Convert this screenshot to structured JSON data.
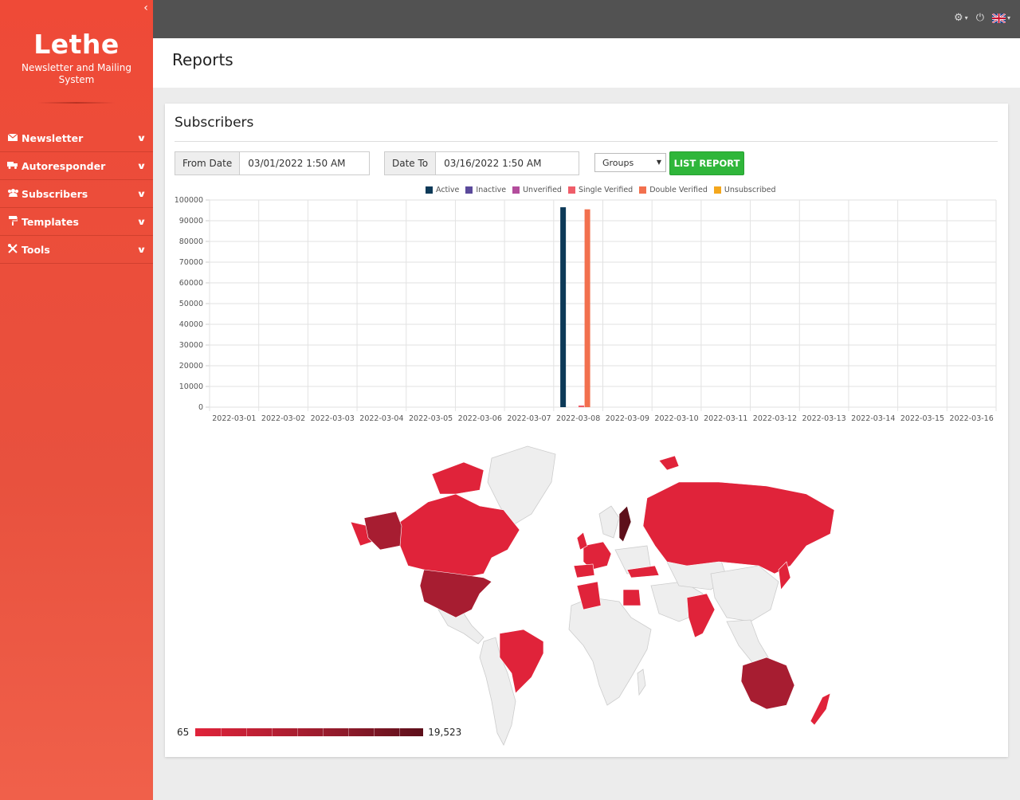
{
  "app": {
    "brand_title": "Lethe",
    "brand_subtitle": "Newsletter and Mailing System",
    "collapse_icon": "chevron-left-icon"
  },
  "sidebar": {
    "items": [
      {
        "label": "Newsletter",
        "icon": "envelope-icon"
      },
      {
        "label": "Autoresponder",
        "icon": "truck-icon"
      },
      {
        "label": "Subscribers",
        "icon": "users-icon"
      },
      {
        "label": "Templates",
        "icon": "paint-roller-icon"
      },
      {
        "label": "Tools",
        "icon": "tools-icon"
      }
    ]
  },
  "topbar": {
    "icons": [
      "gear-icon",
      "power-icon",
      "uk-flag-icon"
    ]
  },
  "page": {
    "title": "Reports"
  },
  "card": {
    "title": "Subscribers",
    "filters": {
      "from_label": "From Date",
      "from_value": "03/01/2022 1:50 AM",
      "to_label": "Date To",
      "to_value": "03/16/2022 1:50 AM",
      "groups_label": "Groups",
      "button_label": "LIST REPORT"
    }
  },
  "chart_data": {
    "type": "bar",
    "categories": [
      "2022-03-01",
      "2022-03-02",
      "2022-03-03",
      "2022-03-04",
      "2022-03-05",
      "2022-03-06",
      "2022-03-07",
      "2022-03-08",
      "2022-03-09",
      "2022-03-10",
      "2022-03-11",
      "2022-03-12",
      "2022-03-13",
      "2022-03-14",
      "2022-03-15",
      "2022-03-16"
    ],
    "series": [
      {
        "name": "Active",
        "color": "#0d3a58",
        "values": [
          0,
          0,
          0,
          0,
          0,
          0,
          0,
          96500,
          0,
          0,
          0,
          0,
          0,
          0,
          0,
          0
        ]
      },
      {
        "name": "Inactive",
        "color": "#5b4a9b",
        "values": [
          0,
          0,
          0,
          0,
          0,
          0,
          0,
          0,
          0,
          0,
          0,
          0,
          0,
          0,
          0,
          0
        ]
      },
      {
        "name": "Unverified",
        "color": "#b34d9c",
        "values": [
          0,
          0,
          0,
          0,
          0,
          0,
          0,
          0,
          0,
          0,
          0,
          0,
          0,
          0,
          0,
          0
        ]
      },
      {
        "name": "Single Verified",
        "color": "#ef5d69",
        "values": [
          0,
          0,
          0,
          0,
          0,
          0,
          0,
          800,
          0,
          0,
          0,
          0,
          0,
          0,
          0,
          0
        ]
      },
      {
        "name": "Double Verified",
        "color": "#f2704e",
        "values": [
          0,
          0,
          0,
          0,
          0,
          0,
          0,
          95500,
          0,
          0,
          0,
          0,
          0,
          0,
          0,
          0
        ]
      },
      {
        "name": "Unsubscribed",
        "color": "#f4a71d",
        "values": [
          0,
          0,
          0,
          0,
          0,
          0,
          0,
          0,
          0,
          0,
          0,
          0,
          0,
          0,
          0,
          0
        ]
      }
    ],
    "yticks": [
      "100000",
      "90000",
      "80000",
      "70000",
      "60000",
      "50000",
      "40000",
      "30000",
      "20000",
      "10000",
      "0"
    ],
    "ylim": [
      0,
      100000
    ],
    "grid": true,
    "legend_position": "top"
  },
  "map": {
    "scale_min": "65",
    "scale_max": "19,523",
    "colors": {
      "low": "#e0233a",
      "mid": "#a71d31",
      "high": "#5d0f1a",
      "none": "#eeeeee",
      "border": "#cccccc"
    }
  }
}
